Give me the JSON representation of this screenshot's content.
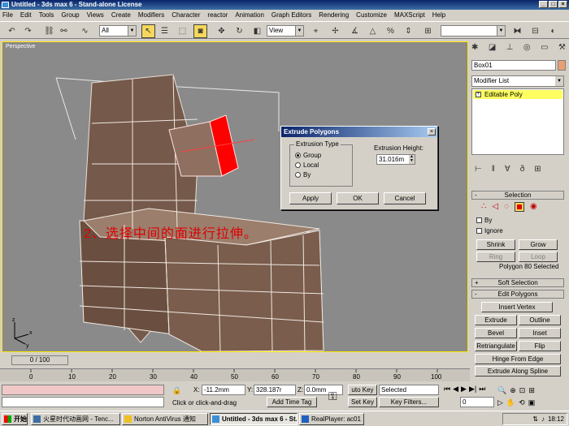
{
  "window": {
    "title": "Untitled - 3ds max 6 - Stand-alone License",
    "controls": [
      "_",
      "□",
      "×"
    ]
  },
  "menu": [
    "File",
    "Edit",
    "Tools",
    "Group",
    "Views",
    "Create",
    "Modifiers",
    "Character",
    "reactor",
    "Animation",
    "Graph Editors",
    "Rendering",
    "Customize",
    "MAXScript",
    "Help"
  ],
  "toolbar": {
    "selection_filter": "All",
    "reference_coord": "View"
  },
  "viewport": {
    "label": "Perspective",
    "annotation": "2、选择中间的面进行拉伸。",
    "axis_labels": [
      "z",
      "x",
      "y"
    ]
  },
  "dialog": {
    "title": "Extrude Polygons",
    "close": "×",
    "group_label": "Extrusion Type",
    "options": [
      "Group",
      "Local",
      "By"
    ],
    "selected_option": "Group",
    "height_label": "Extrusion Height:",
    "height_value": "31.016m",
    "buttons": {
      "apply": "Apply",
      "ok": "OK",
      "cancel": "Cancel"
    }
  },
  "command_panel": {
    "object_name": "Box01",
    "modifier_list": "Modifier List",
    "stack_item": "Editable Poly",
    "selection_header": "Selection",
    "by_label": "By",
    "ignore_label": "Ignore",
    "shrink": "Shrink",
    "grow": "Grow",
    "ring": "Ring",
    "loop": "Loop",
    "status": "Polygon 80 Selected",
    "soft_selection": "Soft Selection",
    "edit_polygons": "Edit Polygons",
    "insert_vertex": "Insert Vertex",
    "extrude": "Extrude",
    "outline": "Outline",
    "bevel": "Bevel",
    "inset": "Inset",
    "retriangulate": "Retriangulate",
    "flip": "Flip",
    "hinge": "Hinge From Edge",
    "extrude_spline": "Extrude Along Spline"
  },
  "timeline": {
    "frame_display": "0 / 100",
    "ticks": [
      "0",
      "10",
      "20",
      "30",
      "40",
      "50",
      "60",
      "70",
      "80",
      "90",
      "100"
    ]
  },
  "status": {
    "prompt": "Click or click-and-drag",
    "add_time_tag": "Add Time Tag",
    "x_label": "X:",
    "x_value": "-11.2mm",
    "y_label": "Y:",
    "y_value": "328.187r",
    "z_label": "Z:",
    "z_value": "0.0mm",
    "auto_key": "uto Key",
    "set_key": "Set Key",
    "key_mode": "Selected",
    "key_filters": "Key Filters...",
    "frame": "0"
  },
  "taskbar": {
    "start": "开始",
    "tasks": [
      "火星时代动画网 - Tenc...",
      "Norton AntiVirus 通知",
      "Untitled - 3ds max 6 - St...",
      "RealPlayer: ac01"
    ],
    "active_index": 2,
    "clock": "18:12"
  }
}
